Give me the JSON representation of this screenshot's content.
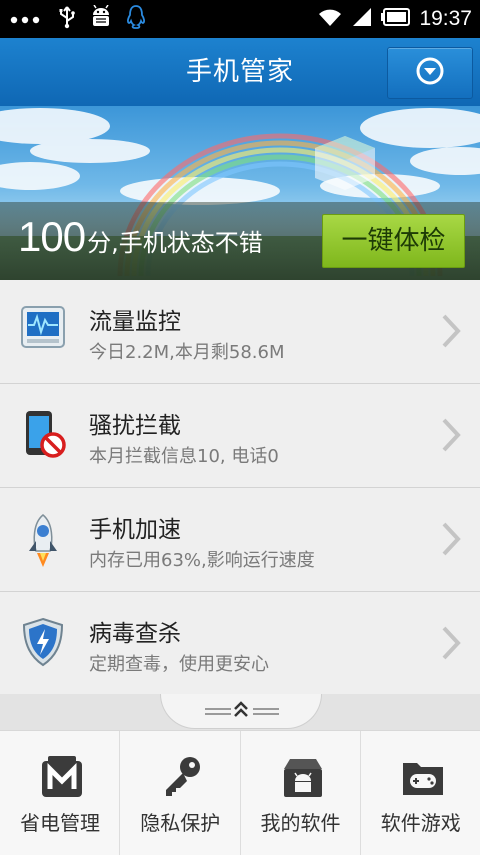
{
  "status_bar": {
    "time": "19:37",
    "left_icons": [
      "more-dots-icon",
      "usb-icon",
      "android-debug-icon",
      "qq-penguin-icon"
    ],
    "right_icons": [
      "wifi-icon",
      "signal-icon",
      "battery-icon"
    ]
  },
  "header": {
    "title": "手机管家",
    "menu_icon": "chevron-down-circle-icon"
  },
  "banner": {
    "score": "100",
    "score_text": "分,手机状态不错",
    "check_button": "一键体检"
  },
  "list": [
    {
      "title": "流量监控",
      "subtitle": "今日2.2M,本月剩58.6M",
      "icon": "traffic-monitor-icon"
    },
    {
      "title": "骚扰拦截",
      "subtitle": "本月拦截信息10, 电话0",
      "icon": "block-phone-icon"
    },
    {
      "title": "手机加速",
      "subtitle": "内存已用63%,影响运行速度",
      "icon": "rocket-icon"
    },
    {
      "title": "病毒查杀",
      "subtitle": "定期查毒，使用更安心",
      "icon": "shield-icon"
    }
  ],
  "bottom_nav": [
    {
      "label": "省电管理",
      "icon": "battery-m-icon"
    },
    {
      "label": "隐私保护",
      "icon": "key-icon"
    },
    {
      "label": "我的软件",
      "icon": "software-box-icon"
    },
    {
      "label": "软件游戏",
      "icon": "game-folder-icon"
    }
  ],
  "colors": {
    "header_blue": "#1478c4",
    "check_green": "#94c832"
  }
}
